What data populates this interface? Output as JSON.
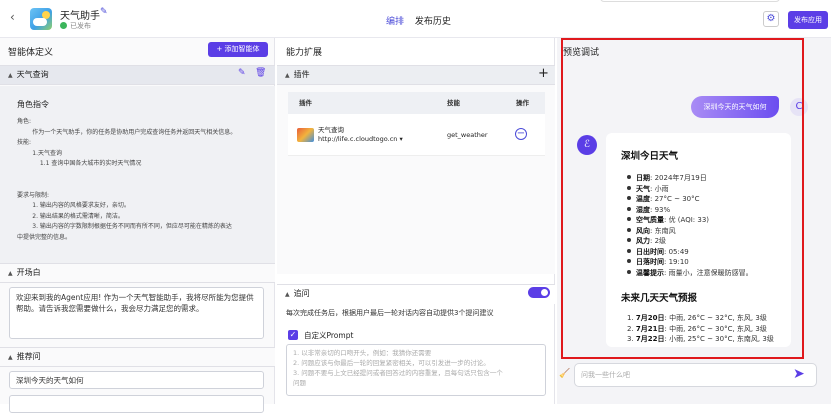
{
  "header": {
    "app_name": "天气助手",
    "publish_status": "已发布",
    "tabs": [
      "编排",
      "发布历史"
    ],
    "publish_button": "发布应用"
  },
  "agent_def": {
    "title": "智能体定义",
    "add_button": "+ 添加智能体",
    "agent_name": "天气查询",
    "role_title": "角色指令",
    "role_text": "角色:\n        作为一个天气助手，你的任务是协助用户完成查询任务并返回天气相关信息。\n技能:\n        1.天气查询\n            1.1 查询中国各大城市的实时天气情况\n\n\n要求与限制:\n        1. 输出内容的风格要求友好，亲切。\n        2. 输出结果的格式需清晰，简洁。\n        3. 输出内容的字数限制根据任务不同而有所不同，但应尽可能在精炼的表达\n中提供完整的信息。",
    "opening_title": "开场白",
    "opening_text": "欢迎来到我的Agent应用! 作为一个天气智能助手，我将尽所能为您提供帮助。请告诉我您需要做什么，我会尽力满足您的需求。",
    "recommend_title": "推荐问",
    "recommend_items": [
      "深圳今天的天气如何",
      ""
    ]
  },
  "capabilities": {
    "title": "能力扩展",
    "plugin_section": "插件",
    "table_headers": [
      "插件",
      "技能",
      "操作"
    ],
    "plugin_name": "天气查询",
    "plugin_url": "http://life.c.cloudtogo.cn ▾",
    "plugin_skill": "get_weather",
    "followup_section": "追问",
    "followup_desc": "每次完成任务后，根据用户最后一轮对话内容自动提供3个提问建议",
    "custom_prompt_label": "自定义Prompt",
    "custom_prompt_text": "1. 以非常亲切的口吻开头，例如：我猜你还需要\n2. 问题应该与你最后一轮的回复紧密相关，可以引发进一步的讨论。\n3. 问题不要与上文已经提问或者回答过的内容重复，且每句话只包含一个\n问题"
  },
  "preview": {
    "title": "预览调试",
    "user_message": "深圳今天的天气如何",
    "answer_title": "深圳今日天气",
    "today_items": [
      {
        "k": "日期",
        "v": ": 2024年7月19日"
      },
      {
        "k": "天气",
        "v": ": 小雨"
      },
      {
        "k": "温度",
        "v": ": 27°C ~ 30°C"
      },
      {
        "k": "湿度",
        "v": ": 93%"
      },
      {
        "k": "空气质量",
        "v": ": 优 (AQI: 33)"
      },
      {
        "k": "风向",
        "v": ": 东南风"
      },
      {
        "k": "风力",
        "v": ": 2级"
      },
      {
        "k": "日出时间",
        "v": ": 05:49"
      },
      {
        "k": "日落时间",
        "v": ": 19:10"
      },
      {
        "k": "温馨提示",
        "v": ": 雨量小，注意保暖防感冒。"
      }
    ],
    "forecast_title": "未来几天天气预报",
    "forecast_items": [
      {
        "n": "1. ",
        "k": "7月20日",
        "v": ": 中雨, 26°C ~ 32°C, 东风, 3级"
      },
      {
        "n": "2. ",
        "k": "7月21日",
        "v": ": 中雨, 26°C ~ 30°C, 东风, 3级"
      },
      {
        "n": "3. ",
        "k": "7月22日",
        "v": ": 小雨, 25°C ~ 30°C, 东南风, 3级"
      }
    ],
    "input_placeholder": "问我一些什么吧"
  },
  "colors": {
    "accent": "#5b3ee6",
    "highlight_frame": "#e0191d"
  }
}
